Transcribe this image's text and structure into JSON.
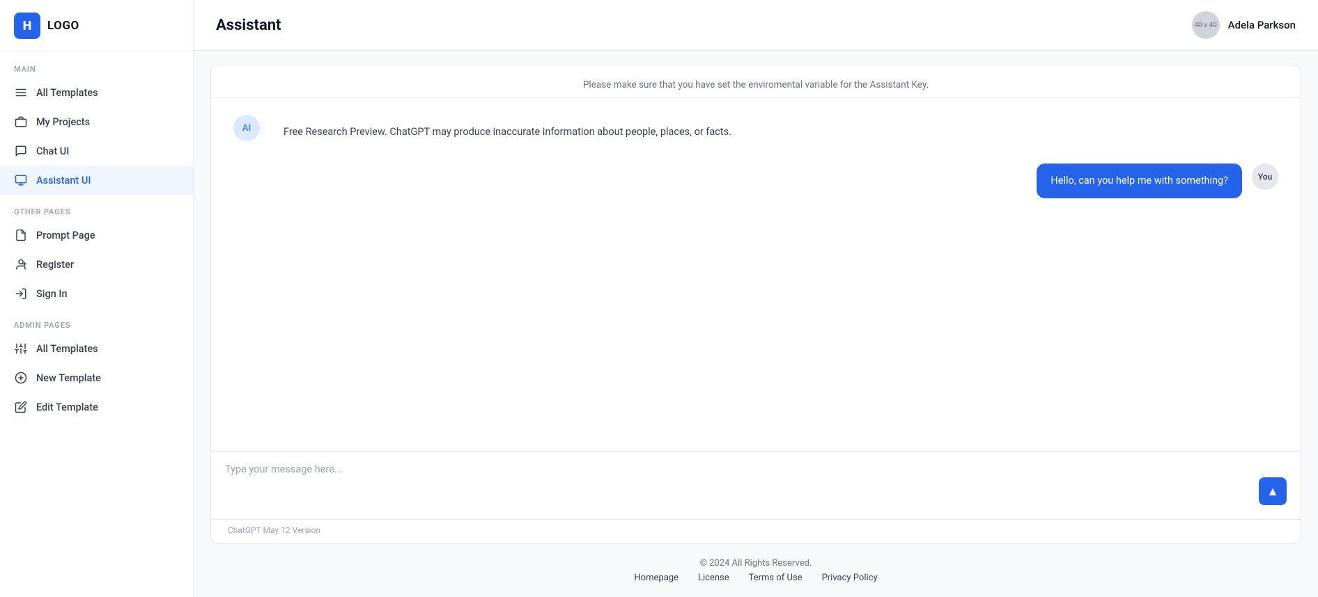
{
  "logo": {
    "letter": "H",
    "text": "LOGO"
  },
  "sidebar": {
    "sections": [
      {
        "label": "MAIN",
        "items": [
          {
            "id": "all-templates",
            "label": "All Templates",
            "icon": "menu"
          },
          {
            "id": "my-projects",
            "label": "My Projects",
            "icon": "briefcase"
          },
          {
            "id": "chat-ui",
            "label": "Chat UI",
            "icon": "chat"
          },
          {
            "id": "assistant-ui",
            "label": "Assistant UI",
            "icon": "monitor",
            "active": true
          }
        ]
      },
      {
        "label": "OTHER PAGES",
        "items": [
          {
            "id": "prompt-page",
            "label": "Prompt Page",
            "icon": "file"
          },
          {
            "id": "register",
            "label": "Register",
            "icon": "user-plus"
          },
          {
            "id": "sign-in",
            "label": "Sign In",
            "icon": "sign-in"
          }
        ]
      },
      {
        "label": "ADMIN PAGES",
        "items": [
          {
            "id": "admin-all-templates",
            "label": "All Templates",
            "icon": "sliders"
          },
          {
            "id": "new-template",
            "label": "New Template",
            "icon": "plus-circle"
          },
          {
            "id": "edit-template",
            "label": "Edit Template",
            "icon": "edit"
          }
        ]
      }
    ]
  },
  "topbar": {
    "title": "Assistant",
    "user": {
      "name": "Adela Parkson",
      "avatar_label": "40 x 40"
    }
  },
  "chat": {
    "env_notice": "Please make sure that you have set the enviromental variable for the Assistant Key.",
    "messages": [
      {
        "role": "ai",
        "avatar": "AI",
        "text": "Free Research Preview. ChatGPT may produce inaccurate information about people, places, or facts."
      },
      {
        "role": "user",
        "avatar": "You",
        "text": "Hello, can you help me with something?"
      }
    ],
    "input_placeholder": "Type your message here...",
    "version_label": "ChatGPT May 12 Version",
    "send_icon": "▲"
  },
  "footer": {
    "copyright": "© 2024 All Rights Reserved.",
    "links": [
      {
        "label": "Homepage"
      },
      {
        "label": "License"
      },
      {
        "label": "Terms of Use"
      },
      {
        "label": "Privacy Policy"
      }
    ]
  }
}
